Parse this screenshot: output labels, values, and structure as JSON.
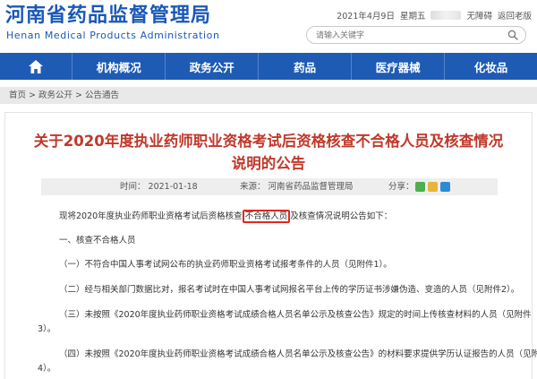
{
  "header": {
    "logo_cn": "河南省药品监督管理局",
    "logo_en": "Henan Medical Products Administration",
    "date": "2021年4月9日",
    "weekday": "星期五",
    "accessibility": "无障碍",
    "old_version": "返回老版",
    "search_placeholder": "请输入关键字"
  },
  "nav": {
    "items": [
      "机构概况",
      "政务公开",
      "药品",
      "医疗器械",
      "化妆品"
    ]
  },
  "breadcrumb": "首页 > 政务公开 > 公告通告",
  "article": {
    "title": "关于2020年度执业药师职业资格考试后资格核查不合格人员及核查情况说明的公告",
    "time": "时间：  2021-01-18",
    "source": "来源：  河南省药品监督管理局",
    "share_label": "分享：",
    "intro_before": "现将2020年度执业药师职业资格考试后资格核查",
    "intro_highlight": "不合格人员",
    "intro_after": "及核查情况说明公告如下：",
    "section1": "一、核查不合格人员",
    "item1": "（一）不符合中国人事考试网公布的执业药师职业资格考试报考条件的人员（见附件1）。",
    "item2": "（二）经与相关部门数据比对，报名考试时在中国人事考试网报名平台上传的学历证书涉嫌伪造、变造的人员（见附件2）。",
    "item3_line1": "（三）未按照《2020年度执业药师职业资格考试成绩合格人员名单公示及核查公告》规定的时间上传核查材料的人员（见附件",
    "item3_line2": "3）。",
    "item4_line1": "（四）未按照《2020年度执业药师职业资格考试成绩合格人员名单公示及核查公告》的材料要求提供学历认证报告的人员（见附件",
    "item4_line2": "4）。"
  },
  "colors": {
    "brand_blue": "#1e5bb5",
    "title_red": "#c0392b",
    "highlight_red": "#e0281c"
  }
}
